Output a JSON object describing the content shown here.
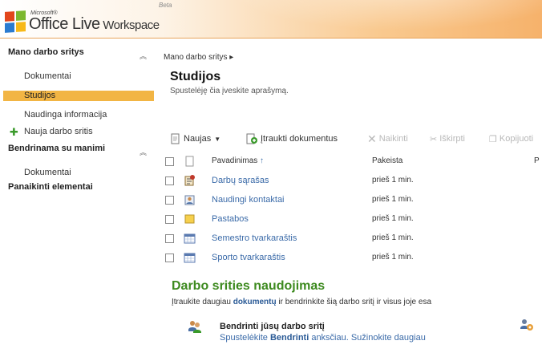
{
  "header": {
    "ms_label": "Microsoft®",
    "product": "Office Live",
    "product_suffix": " Workspace",
    "beta": "Beta",
    "colors": {
      "orange": "#f6b26b",
      "sq_red": "#e2461b",
      "sq_green": "#7cb82f",
      "sq_blue": "#2b7bd0",
      "sq_yellow": "#f7b919"
    }
  },
  "sidebar": {
    "section1": "Mano darbo sritys",
    "items1": [
      "Dokumentai",
      "Studijos",
      "Naudinga informacija"
    ],
    "selected": "Studijos",
    "new_space": "Nauja darbo sritis",
    "section2": "Bendrinama su manimi",
    "items2": [
      "Dokumentai"
    ],
    "section3": "Panaikinti elementai",
    "icons": {
      "collapse": "collapse-icon",
      "add": "plus-icon"
    }
  },
  "main": {
    "breadcrumb": "Mano darbo sritys",
    "title": "Studijos",
    "description": "Spustelėję čia įveskite aprašymą.",
    "toolbar": {
      "new": "Naujas",
      "upload": "Įtraukti dokumentus",
      "delete": "Naikinti",
      "cut": "Iškirpti",
      "copy": "Kopijuoti"
    },
    "table": {
      "col_name": "Pavadinimas",
      "col_modified": "Pakeista",
      "col_extra": "P",
      "rows": [
        {
          "name": "Darbų sąrašas",
          "modified": "prieš 1 min.",
          "icon": "task-list-icon"
        },
        {
          "name": "Naudingi kontaktai",
          "modified": "prieš 1 min.",
          "icon": "contacts-icon"
        },
        {
          "name": "Pastabos",
          "modified": "prieš 1 min.",
          "icon": "notes-icon"
        },
        {
          "name": "Semestro tvarkaraštis",
          "modified": "prieš 1 min.",
          "icon": "calendar-icon"
        },
        {
          "name": "Sporto tvarkaraštis",
          "modified": "prieš 1 min.",
          "icon": "calendar-icon"
        }
      ]
    },
    "usage": {
      "title": "Darbo srities naudojimas",
      "text_pre": "Įtraukite daugiau ",
      "text_link": "dokumentų",
      "text_post": " ir bendrinkite šią darbo sritį ir visus joje esa",
      "share_title": "Bendrinti jūsų darbo sritį",
      "share_pre": "Spustelėkite ",
      "share_bold": "Bendrinti",
      "share_post": " anksčiau. Sužinokite daugiau"
    }
  }
}
